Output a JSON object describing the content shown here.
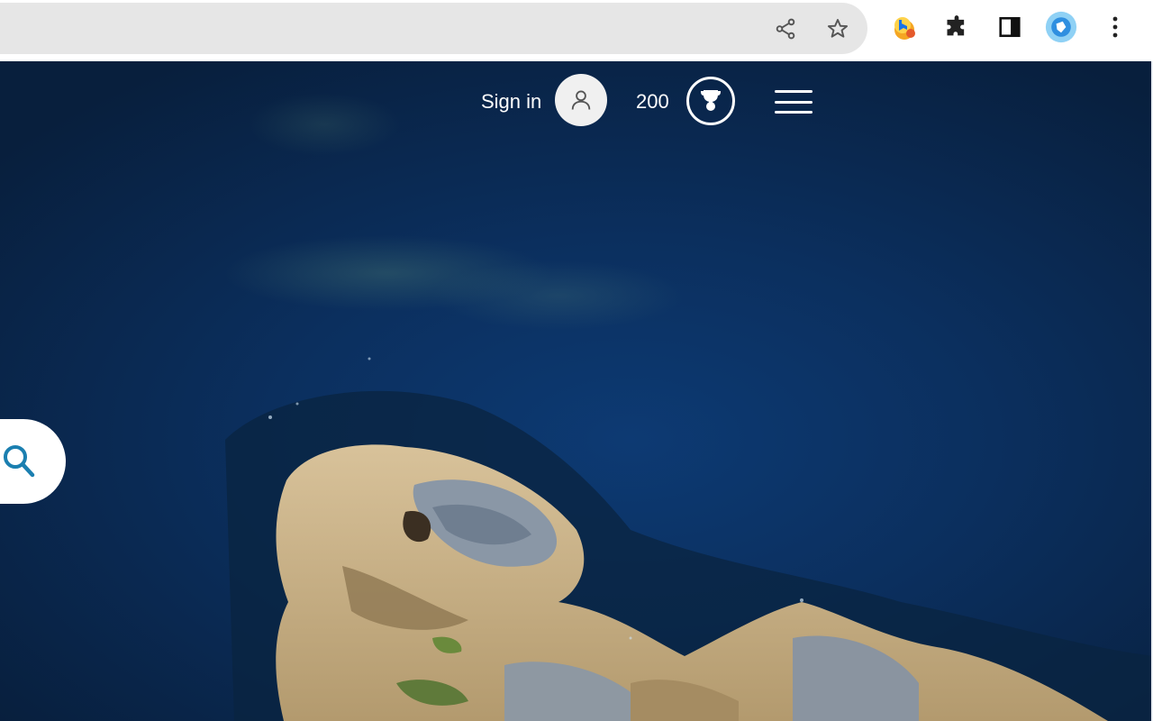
{
  "browser": {
    "icons": {
      "share": "share-icon",
      "bookmark": "star-icon",
      "bing": "bing-extension-icon",
      "extensions": "puzzle-icon",
      "side_panel": "side-panel-icon",
      "profile": "profile-avatar-icon",
      "menu": "kebab-menu-icon"
    }
  },
  "header": {
    "sign_in_label": "Sign in",
    "points": "200",
    "icons": {
      "user": "user-icon",
      "rewards": "trophy-icon",
      "menu": "hamburger-icon"
    }
  },
  "search": {
    "icon": "search-icon",
    "accent": "#1b7fb0"
  },
  "colors": {
    "ocean": "#0b2f5e",
    "toolbar": "#ffffff",
    "omnibox": "#e6e6e6"
  }
}
